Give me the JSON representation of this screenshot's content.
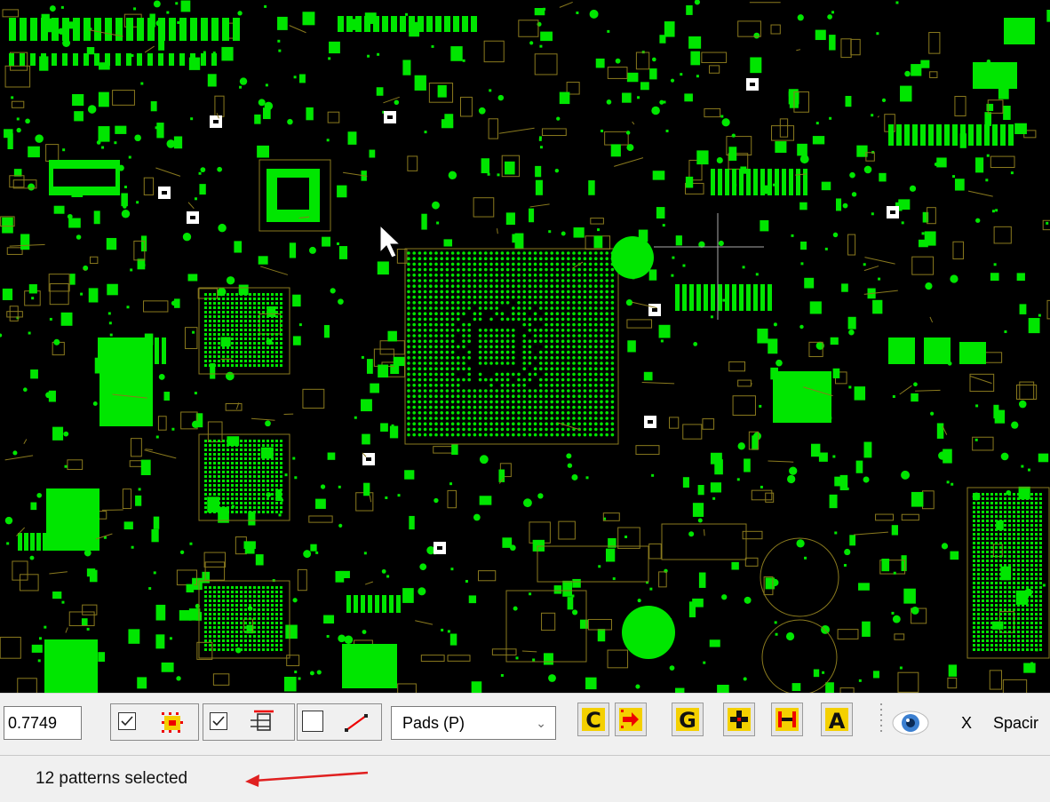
{
  "toolbar": {
    "coord_value": "0.7749",
    "pads_select_value": "Pads   (P)",
    "x_label": "X",
    "spacing_label": "Spacir",
    "buttons": [
      {
        "name": "C",
        "icon": "C-letter-icon"
      },
      {
        "name": "arrow-right-dots",
        "icon": "arrow-right-dots-icon"
      },
      {
        "name": "G",
        "icon": "G-letter-icon"
      },
      {
        "name": "cross",
        "icon": "cross-dots-icon"
      },
      {
        "name": "h-bar",
        "icon": "h-bar-dots-icon"
      },
      {
        "name": "A",
        "icon": "A-letter-icon"
      }
    ],
    "checkbox_1_checked": true,
    "checkbox_2_checked": true,
    "checkbox_3_checked": false
  },
  "status": {
    "text": "12 patterns selected"
  },
  "colors": {
    "pcb_background": "#000000",
    "pad_green": "#00e600",
    "silkscreen": "#8a7a1e",
    "toolbar_bg": "#f0f0f0",
    "annotation_arrow": "#e02020"
  }
}
